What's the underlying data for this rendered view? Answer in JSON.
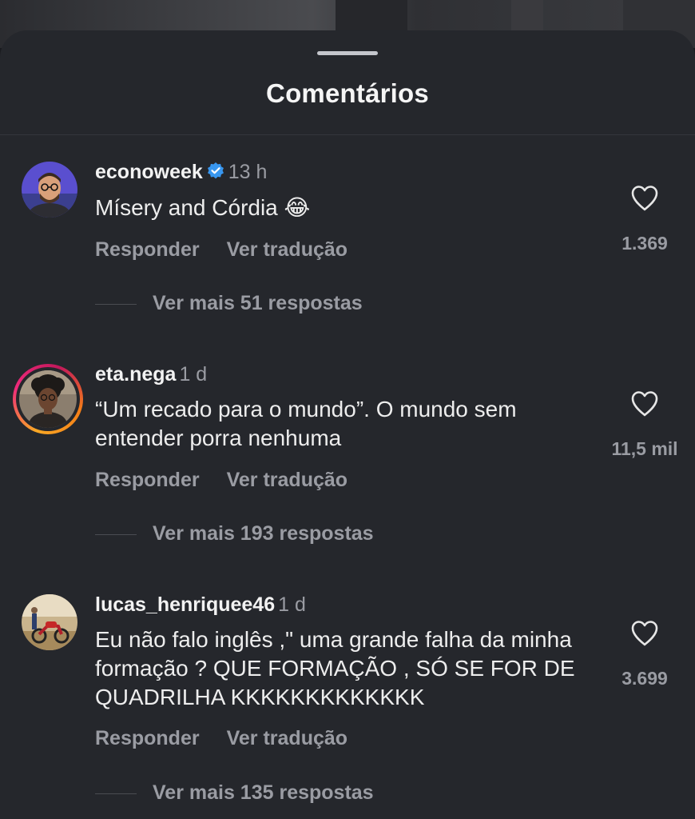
{
  "sheet": {
    "title": "Comentários"
  },
  "colors": {
    "background": "#25272c",
    "verified_badge": "#3897f0"
  },
  "comments": [
    {
      "username": "econoweek",
      "verified": true,
      "time": "13 h",
      "text": "Mísery and Córdia 😂",
      "reply_label": "Responder",
      "translate_label": "Ver tradução",
      "likes": "1.369",
      "more_replies": "Ver mais 51 respostas",
      "avatar_icon": "avatar-man-glasses-icon"
    },
    {
      "username": "eta.nega",
      "verified": false,
      "time": "1 d",
      "text": "“Um recado para o mundo”. O mundo sem entender porra nenhuma",
      "reply_label": "Responder",
      "translate_label": "Ver tradução",
      "likes": "11,5 mil",
      "more_replies": "Ver mais 193 respostas",
      "avatar_icon": "avatar-woman-curly-hair-icon"
    },
    {
      "username": "lucas_henriquee46",
      "verified": false,
      "time": "1 d",
      "text": "Eu não falo inglês ,\" uma grande falha da minha formação ? QUE FORMAÇÃO , SÓ SE FOR DE QUADRILHA KKKKKKKKKKKKK",
      "reply_label": "Responder",
      "translate_label": "Ver tradução",
      "likes": "3.699",
      "more_replies": "Ver mais 135 respostas",
      "avatar_icon": "avatar-motorcycle-photo-icon"
    }
  ]
}
